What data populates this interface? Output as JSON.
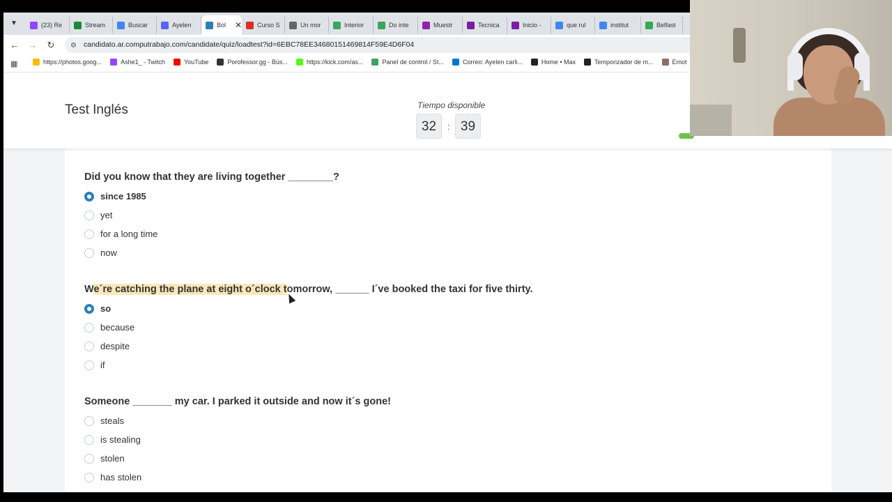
{
  "browser": {
    "tabs": [
      {
        "label": "(23) Re",
        "color": "#9147ff"
      },
      {
        "label": "Stream",
        "color": "#1a8a3a"
      },
      {
        "label": "Buscar",
        "color": "#4285f4"
      },
      {
        "label": "Ayelen",
        "color": "#5865f2"
      },
      {
        "label": "Bol",
        "color": "#2e7fb8",
        "active": true
      },
      {
        "label": "Curso S",
        "color": "#d93025"
      },
      {
        "label": "Un mor",
        "color": "#666666"
      },
      {
        "label": "Interior",
        "color": "#3ba55c"
      },
      {
        "label": "Do inte",
        "color": "#3ba55c"
      },
      {
        "label": "Muestr",
        "color": "#8e24aa"
      },
      {
        "label": "Tecnica",
        "color": "#7b1fa2"
      },
      {
        "label": "Inicio -",
        "color": "#7b1fa2"
      },
      {
        "label": "que rul",
        "color": "#4285f4"
      },
      {
        "label": "institut",
        "color": "#4285f4"
      },
      {
        "label": "Belfast",
        "color": "#34a853"
      }
    ],
    "tab_close": "✕",
    "url": "candidato.ar.computrabajo.com/candidate/quiz/loadtest?id=6EBC78EE34680151469814F59E4D6F04",
    "bookmarks": [
      {
        "label": "https://photos.goog...",
        "color": "#fbbc05"
      },
      {
        "label": "Ashe1_ - Twitch",
        "color": "#9147ff"
      },
      {
        "label": "YouTube",
        "color": "#ff0000"
      },
      {
        "label": "Porofessor.gg - Bús...",
        "color": "#333333"
      },
      {
        "label": "https://kick.com/as...",
        "color": "#53fc18"
      },
      {
        "label": "Panel de control / St...",
        "color": "#3ba55c"
      },
      {
        "label": "Correo: Ayelen carli...",
        "color": "#0078d4"
      },
      {
        "label": "Home • Max",
        "color": "#222222"
      },
      {
        "label": "Temporizador de m...",
        "color": "#222222"
      },
      {
        "label": "Emot",
        "color": "#8d6e63"
      }
    ]
  },
  "page": {
    "title": "Test Inglés",
    "timer": {
      "label": "Tiempo disponible",
      "minutes": "32",
      "separator": ":",
      "seconds": "39"
    }
  },
  "questions": [
    {
      "text": "Did you know that they are living together ________?",
      "options": [
        {
          "label": "since 1985",
          "selected": true
        },
        {
          "label": "yet",
          "selected": false
        },
        {
          "label": "for a long time",
          "selected": false
        },
        {
          "label": "now",
          "selected": false
        }
      ]
    },
    {
      "text_pre": "W",
      "text_highlight": "e´re catching the plane at eight o´clock t",
      "text_post": "omorrow, ______ I´ve booked the taxi for five thirty.",
      "options": [
        {
          "label": "so",
          "selected": true
        },
        {
          "label": "because",
          "selected": false
        },
        {
          "label": "despite",
          "selected": false
        },
        {
          "label": "if",
          "selected": false
        }
      ]
    },
    {
      "text": "Someone _______ my car. I parked it outside and now it´s gone!",
      "options": [
        {
          "label": "steals",
          "selected": false
        },
        {
          "label": "is stealing",
          "selected": false
        },
        {
          "label": "stolen",
          "selected": false
        },
        {
          "label": "has stolen",
          "selected": false
        }
      ]
    }
  ],
  "colors": {
    "accent": "#2e7fb8",
    "highlight": "#fbe7b9",
    "progress": "#6cc24a"
  }
}
